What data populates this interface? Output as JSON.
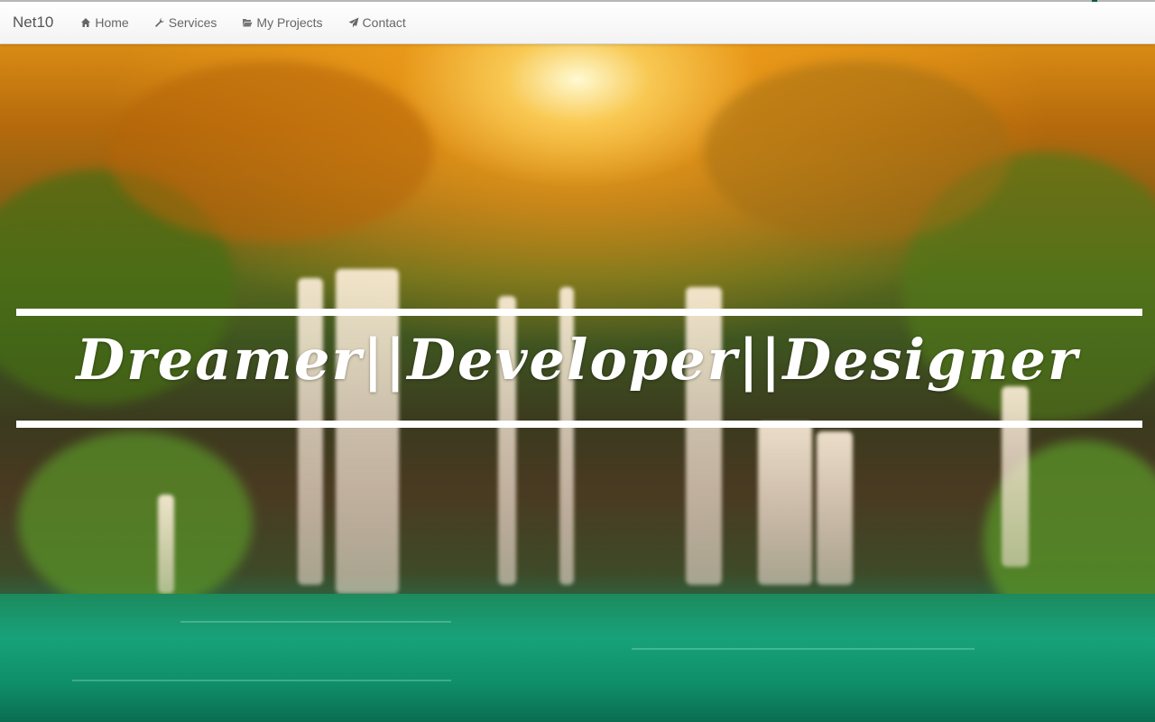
{
  "navbar": {
    "brand": "Net10",
    "items": [
      {
        "label": "Home",
        "icon": "home-icon"
      },
      {
        "label": "Services",
        "icon": "wrench-icon"
      },
      {
        "label": "My Projects",
        "icon": "folder-open-icon"
      },
      {
        "label": "Contact",
        "icon": "paper-plane-icon"
      }
    ]
  },
  "hero": {
    "headline": "Dreamer||Developer||Designer",
    "background": "forest-waterfall-sunrise-photo"
  },
  "colors": {
    "navbar_bg": "#f7f7f7",
    "nav_text": "#666666",
    "headline": "#ffffff"
  }
}
